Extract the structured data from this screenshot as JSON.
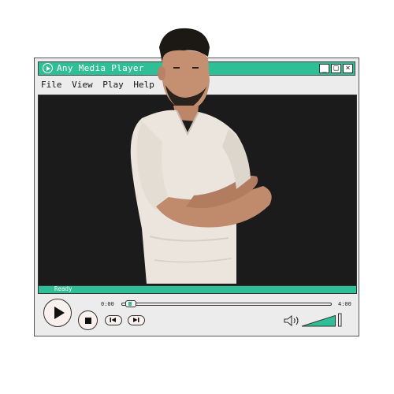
{
  "window": {
    "title": "Any Media Player",
    "controls": [
      "_",
      "□",
      "×"
    ]
  },
  "menu": [
    {
      "label": "File"
    },
    {
      "label": "View"
    },
    {
      "label": "Play"
    },
    {
      "label": "Help"
    }
  ],
  "status": {
    "text": "Ready"
  },
  "playback": {
    "current_time": "0:00",
    "total_time": "4:00",
    "progress": 0.02,
    "volume": 0.85
  },
  "icons": {
    "app": "play-circle-icon",
    "play": "play-icon",
    "stop": "stop-icon",
    "previous": "skip-previous-icon",
    "next": "skip-next-icon",
    "volume": "speaker-icon"
  },
  "colors": {
    "accent": "#2fbf97",
    "screen": "#1b1b1b",
    "window_bg": "#ececec"
  }
}
